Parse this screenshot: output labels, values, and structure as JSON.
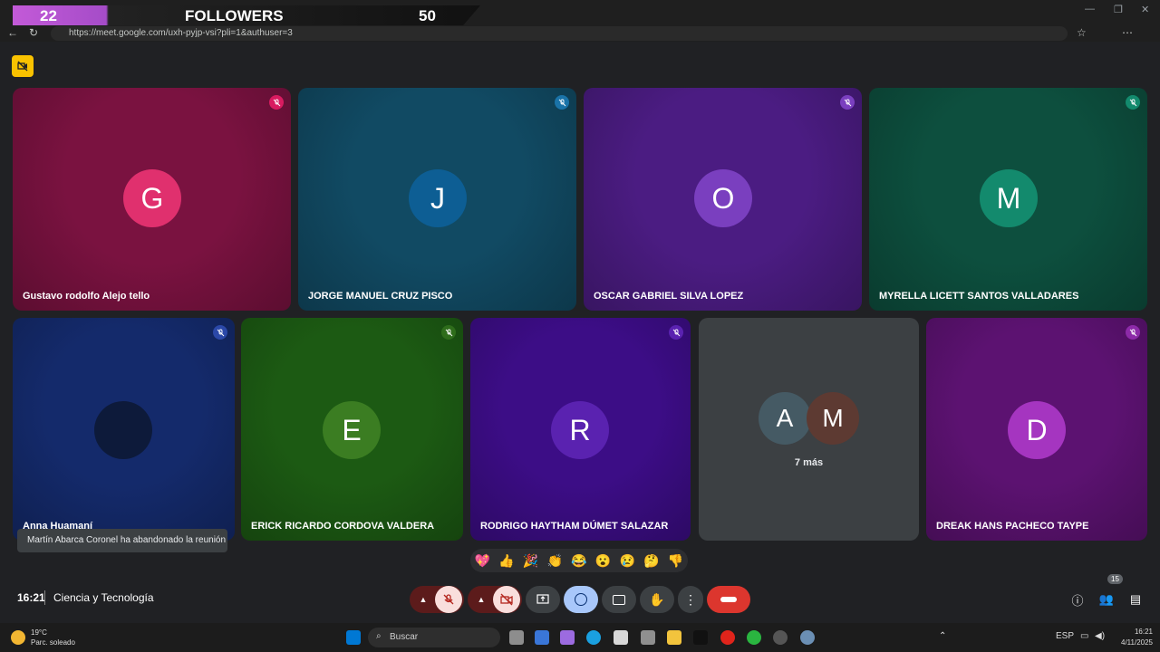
{
  "overlay": {
    "count_left": "22",
    "label": "FOLLOWERS",
    "count_right": "50"
  },
  "browser": {
    "url": "https://meet.google.com/uxh-pyjp-vsi?pli=1&authuser=3"
  },
  "participants": [
    {
      "initial": "G",
      "name": "Gustavo rodolfo Alejo tello",
      "bg": "#7a1240",
      "avatar": "#e0306e",
      "mic": "#d81b60"
    },
    {
      "initial": "J",
      "name": "JORGE MANUEL CRUZ PISCO",
      "bg": "#114a63",
      "avatar": "#0d5e94",
      "mic": "#1a73a8"
    },
    {
      "initial": "O",
      "name": "OSCAR GABRIEL SILVA LOPEZ",
      "bg": "#4b1c82",
      "avatar": "#7a3fbf",
      "mic": "#7a3fbf"
    },
    {
      "initial": "M",
      "name": "MYRELLA LICETT SANTOS VALLADARES",
      "bg": "#0d4f3e",
      "avatar": "#138a6d",
      "mic": "#138a6d"
    },
    {
      "initial": "",
      "name": "Anna Huamaní",
      "bg": "#142a6b",
      "avatar": "#0d1a3a",
      "mic": "#2b48a8"
    },
    {
      "initial": "E",
      "name": "ERICK RICARDO CORDOVA VALDERA",
      "bg": "#1c5a13",
      "avatar": "#3b7d22",
      "mic": "#2e6d1b"
    },
    {
      "initial": "R",
      "name": "RODRIGO HAYTHAM DÚMET SALAZAR",
      "bg": "#3c0d86",
      "avatar": "#5a22b0",
      "mic": "#5a22b0"
    },
    {
      "initial": "D",
      "name": "DREAK HANS PACHECO TAYPE",
      "bg": "#5c1271",
      "avatar": "#a535c0",
      "mic": "#8c2aa8"
    }
  ],
  "more_tile": {
    "avatar1": "A",
    "avatar2": "M",
    "label": "7 más"
  },
  "toast": "Martín Abarca Coronel ha abandonado la reunión",
  "reactions": [
    "💖",
    "👍",
    "🎉",
    "👏",
    "😂",
    "😮",
    "😢",
    "🤔",
    "👎"
  ],
  "footer": {
    "time": "16:21",
    "meeting": "Ciencia y Tecnología",
    "people_count": "15"
  },
  "taskbar": {
    "weather_temp": "19°C",
    "weather_desc": "Parc. soleado",
    "search": "Buscar",
    "lang": "ESP",
    "clock_time": "16:21",
    "clock_date": "4/11/2025"
  }
}
